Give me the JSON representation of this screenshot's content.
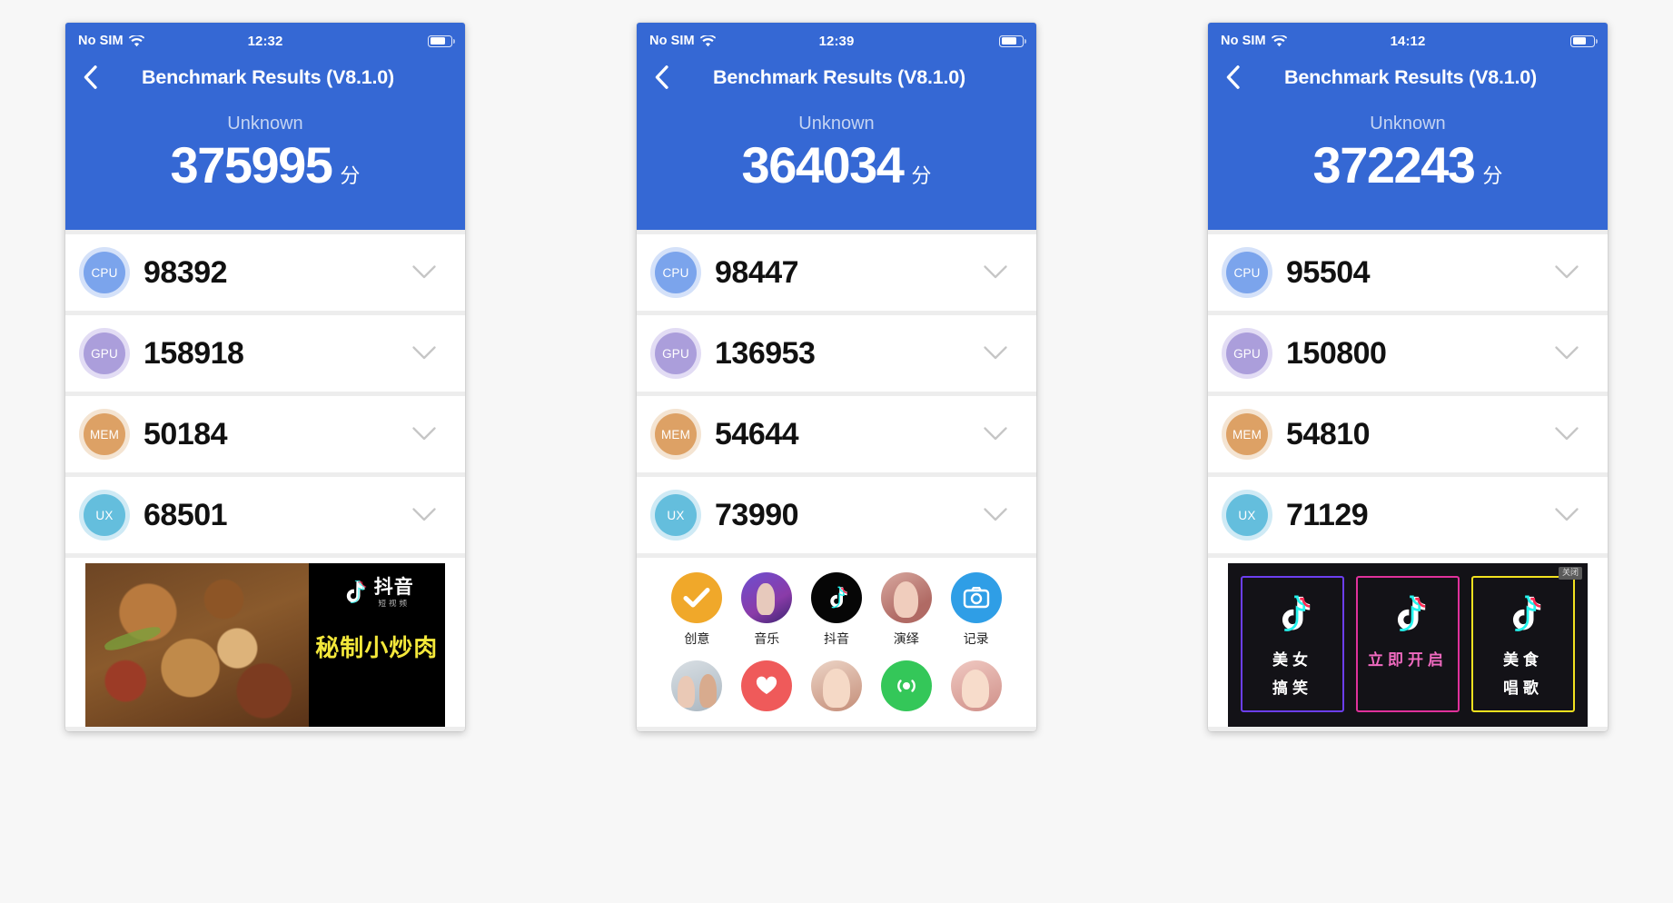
{
  "app": {
    "nav_title": "Benchmark Results (V8.1.0)",
    "back_icon": "chevron-left-icon",
    "device_label": "Unknown",
    "score_unit": "分"
  },
  "phones": [
    {
      "status": {
        "carrier": "No SIM",
        "wifi_icon": "wifi-icon",
        "time": "12:32",
        "battery_icon": "battery-icon"
      },
      "nav_title": "Benchmark Results (V8.1.0)",
      "device_label": "Unknown",
      "total_score": "375995",
      "score_unit": "分",
      "rows": [
        {
          "badge": "CPU",
          "score": "98392",
          "chevron": "chevron-down-icon"
        },
        {
          "badge": "GPU",
          "score": "158918",
          "chevron": "chevron-down-icon"
        },
        {
          "badge": "MEM",
          "score": "50184",
          "chevron": "chevron-down-icon"
        },
        {
          "badge": "UX",
          "score": "68501",
          "chevron": "chevron-down-icon"
        }
      ],
      "ad": {
        "type": "food-banner",
        "brand_cn": "抖音",
        "brand_sub": "短视频",
        "slogan": "秘制小炒肉"
      }
    },
    {
      "status": {
        "carrier": "No SIM",
        "wifi_icon": "wifi-icon",
        "time": "12:39",
        "battery_icon": "battery-icon"
      },
      "nav_title": "Benchmark Results (V8.1.0)",
      "device_label": "Unknown",
      "total_score": "364034",
      "score_unit": "分",
      "rows": [
        {
          "badge": "CPU",
          "score": "98447",
          "chevron": "chevron-down-icon"
        },
        {
          "badge": "GPU",
          "score": "136953",
          "chevron": "chevron-down-icon"
        },
        {
          "badge": "MEM",
          "score": "54644",
          "chevron": "chevron-down-icon"
        },
        {
          "badge": "UX",
          "score": "73990",
          "chevron": "chevron-down-icon"
        }
      ],
      "ad": {
        "type": "icon-grid",
        "row1": [
          {
            "label": "创意",
            "icon": "check-mark-icon"
          },
          {
            "label": "音乐",
            "icon": "singer-photo-icon"
          },
          {
            "label": "抖音",
            "icon": "tiktok-note-icon"
          },
          {
            "label": "演绎",
            "icon": "actress-photo-icon"
          },
          {
            "label": "记录",
            "icon": "camera-icon"
          }
        ],
        "row2": [
          {
            "label": "",
            "icon": "duo-photo-icon"
          },
          {
            "label": "",
            "icon": "heart-icon"
          },
          {
            "label": "",
            "icon": "girl-photo-icon"
          },
          {
            "label": "",
            "icon": "sound-wave-icon"
          },
          {
            "label": "",
            "icon": "portrait-photo-icon"
          }
        ]
      }
    },
    {
      "status": {
        "carrier": "No SIM",
        "wifi_icon": "wifi-icon",
        "time": "14:12",
        "battery_icon": "battery-icon"
      },
      "nav_title": "Benchmark Results (V8.1.0)",
      "device_label": "Unknown",
      "total_score": "372243",
      "score_unit": "分",
      "rows": [
        {
          "badge": "CPU",
          "score": "95504",
          "chevron": "chevron-down-icon"
        },
        {
          "badge": "GPU",
          "score": "150800",
          "chevron": "chevron-down-icon"
        },
        {
          "badge": "MEM",
          "score": "54810",
          "chevron": "chevron-down-icon"
        },
        {
          "badge": "UX",
          "score": "71129",
          "chevron": "chevron-down-icon"
        }
      ],
      "ad": {
        "type": "dark-triple",
        "close_label": "关闭",
        "cards": [
          {
            "title": "美女",
            "subtitle": "搞笑",
            "border_color": "#6c3ef0"
          },
          {
            "title": "立即开启",
            "subtitle": "",
            "border_color": "#e0319b"
          },
          {
            "title": "美食",
            "subtitle": "唱歌",
            "border_color": "#f2e11f"
          }
        ]
      }
    }
  ],
  "colors": {
    "header_blue": "#3568d4",
    "cpu": "#7ba4ec",
    "gpu": "#ab9edb",
    "mem": "#dda165",
    "ux": "#64bedd",
    "page_bg": "#f7f7f7",
    "device_label": "#c5d4f2"
  }
}
